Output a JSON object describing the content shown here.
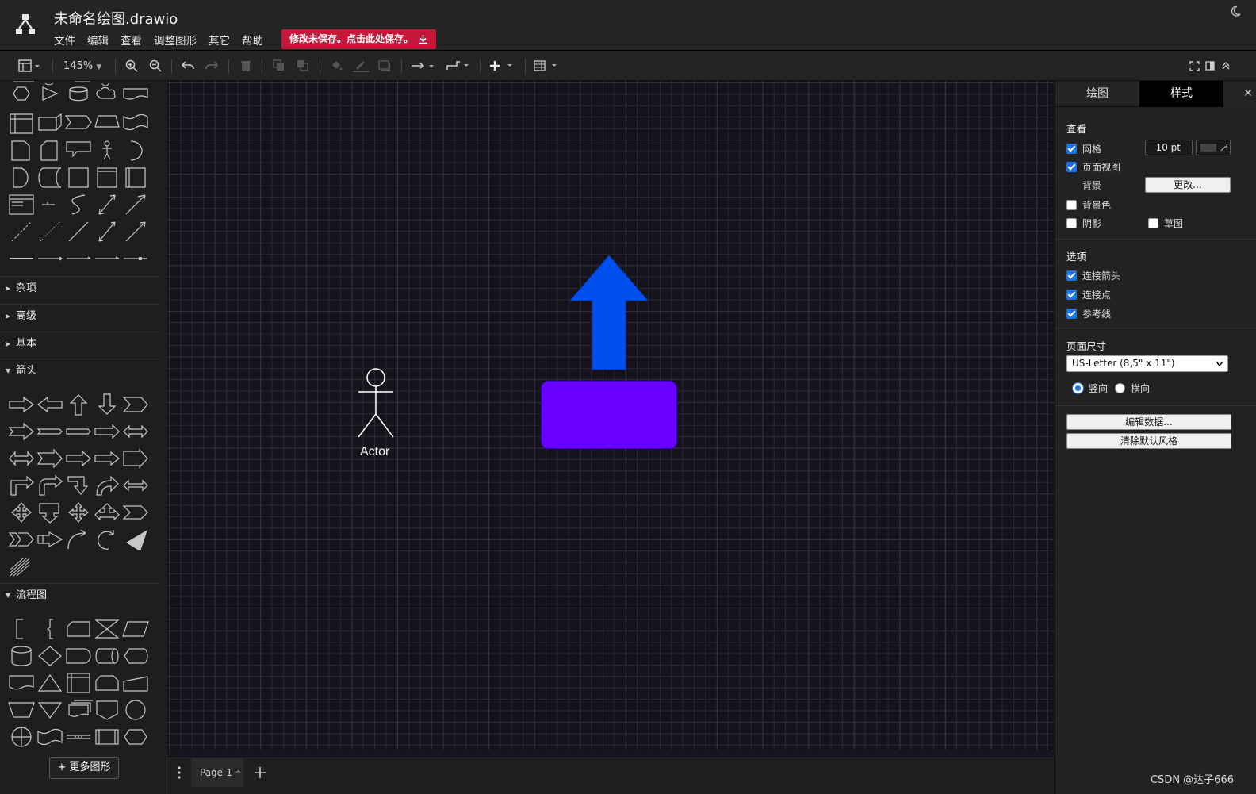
{
  "header": {
    "title": "未命名绘图.drawio",
    "menu": [
      "文件",
      "编辑",
      "查看",
      "调整图形",
      "其它",
      "帮助"
    ],
    "unsaved_notice": "修改未保存。点击此处保存。"
  },
  "toolbar": {
    "zoom": "145%"
  },
  "sidebar": {
    "categories": {
      "misc": "杂项",
      "advanced": "高级",
      "basic": "基本",
      "arrows": "箭头",
      "flowchart": "流程图"
    },
    "more_shapes": "+ 更多图形"
  },
  "canvas": {
    "actor_label": "Actor",
    "arrow_color": "#0050ef",
    "rect_color": "#6a00ff"
  },
  "bottom": {
    "page_tab": "Page-1"
  },
  "panel": {
    "tabs": [
      "绘图",
      "样式"
    ],
    "view_heading": "查看",
    "grid_label": "网格",
    "grid_size": "10 pt",
    "page_view_label": "页面视图",
    "background_label": "背景",
    "change_button": "更改...",
    "bg_color_label": "背景色",
    "shadow_label": "阴影",
    "sketch_label": "草图",
    "options_heading": "选项",
    "connection_arrows": "连接箭头",
    "connection_points": "连接点",
    "guides": "参考线",
    "page_size_heading": "页面尺寸",
    "page_size_value": "US-Letter (8,5\" x 11\")",
    "portrait": "竖向",
    "landscape": "横向",
    "edit_data": "编辑数据...",
    "clear_default_style": "清除默认风格"
  },
  "watermark": "CSDN @达子666"
}
